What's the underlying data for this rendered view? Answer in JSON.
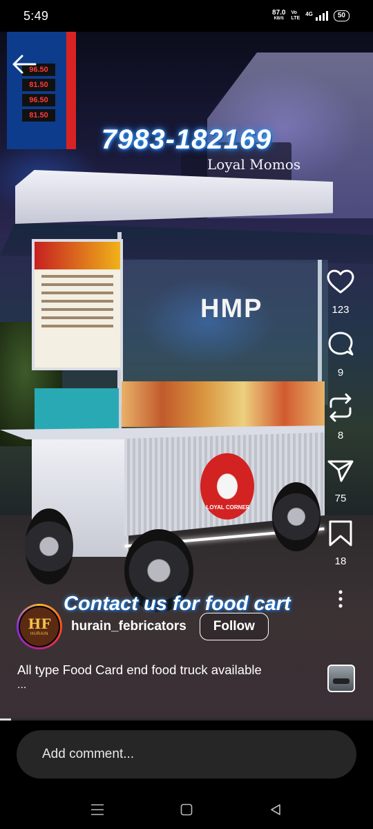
{
  "status_bar": {
    "time": "5:49",
    "net_speed": "87.0",
    "net_speed_unit": "KB/S",
    "volte_top": "Vo",
    "volte_bottom": "LTE",
    "network": "4G",
    "battery": "50"
  },
  "video": {
    "overlay_phone": "7983-182169",
    "overlay_contact": "Contact us for food cart",
    "sign_text": "Loyal Momos",
    "glass_text": "HMP",
    "cart_logo_text": "LOYAL CORNER",
    "progress_fraction": 0.03,
    "fuel_prices": [
      "96.50",
      "81.50",
      "96.50",
      "81.50"
    ]
  },
  "actions": {
    "likes": "123",
    "comments": "9",
    "reposts": "8",
    "shares": "75",
    "saves": "18"
  },
  "author": {
    "username": "hurain_febricators",
    "avatar_monogram": "HF",
    "avatar_name": "HURAIN",
    "follow_label": "Follow"
  },
  "caption": {
    "text": "All type Food Card end food truck available",
    "more": "..."
  },
  "comment": {
    "placeholder": "Add comment..."
  },
  "icons": {
    "back": "back-arrow-icon",
    "like": "heart-icon",
    "comment": "comment-bubble-icon",
    "repost": "repost-icon",
    "share": "send-icon",
    "save": "bookmark-icon",
    "more": "more-vertical-icon",
    "nav_recent": "menu-lines-icon",
    "nav_home": "square-home-icon",
    "nav_back": "triangle-back-icon"
  },
  "colors": {
    "overlay_glow": "#3aa0ff",
    "comment_box": "#262626",
    "background": "#000000"
  }
}
